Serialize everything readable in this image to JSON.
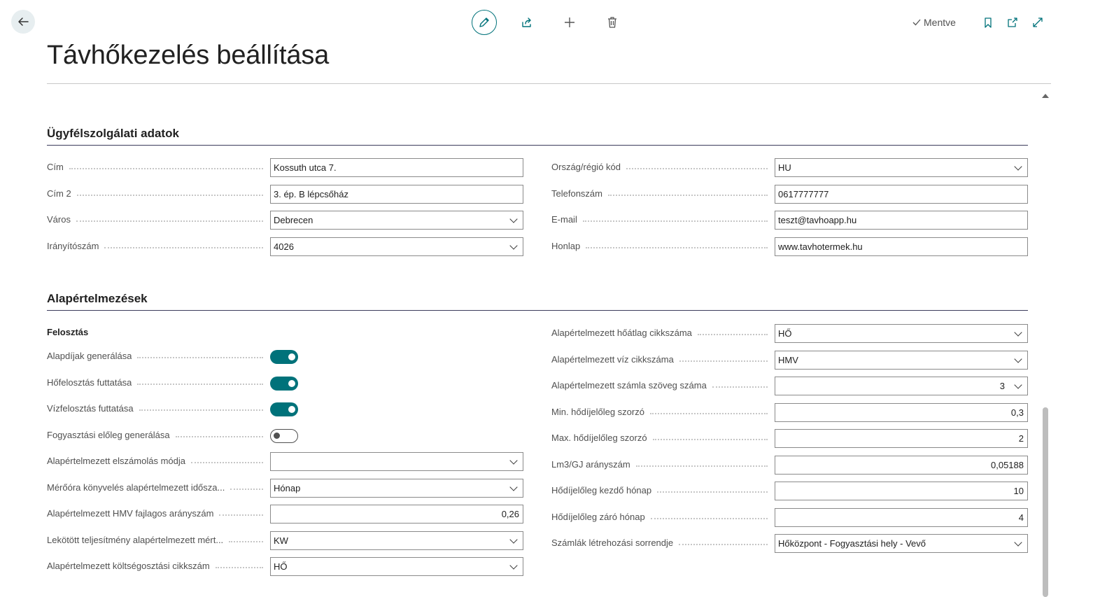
{
  "header": {
    "title": "Távhőkezelés beállítása",
    "saved_label": "Mentve"
  },
  "toolbar": {
    "icons": [
      "edit-icon",
      "share-icon",
      "plus-icon",
      "trash-icon",
      "bookmark-icon",
      "open-new-window-icon",
      "expand-icon"
    ]
  },
  "customer_service": {
    "title": "Ügyfélszolgálati adatok",
    "left": [
      {
        "label": "Cím",
        "value": "Kossuth utca 7.",
        "type": "text"
      },
      {
        "label": "Cím 2",
        "value": "3. ép. B lépcsőház",
        "type": "text"
      },
      {
        "label": "Város",
        "value": "Debrecen",
        "type": "select"
      },
      {
        "label": "Irányítószám",
        "value": "4026",
        "type": "select"
      }
    ],
    "right": [
      {
        "label": "Ország/régió kód",
        "value": "HU",
        "type": "select"
      },
      {
        "label": "Telefonszám",
        "value": "0617777777",
        "type": "text"
      },
      {
        "label": "E-mail",
        "value": "teszt@tavhoapp.hu",
        "type": "text"
      },
      {
        "label": "Honlap",
        "value": "www.tavhotermek.hu",
        "type": "text"
      }
    ]
  },
  "defaults": {
    "title": "Alapértelmezések",
    "group_title": "Felosztás",
    "toggles": [
      {
        "label": "Alapdíjak generálása",
        "on": true
      },
      {
        "label": "Hőfelosztás futtatása",
        "on": true
      },
      {
        "label": "Vízfelosztás futtatása",
        "on": true
      },
      {
        "label": "Fogyasztási előleg generálása",
        "on": false
      }
    ],
    "left_fields": [
      {
        "label": "Alapértelmezett elszámolás módja",
        "value": "",
        "type": "select"
      },
      {
        "label": "Mérőóra könyvelés alapértelmezett idősza...",
        "value": "Hónap",
        "type": "select"
      },
      {
        "label": "Alapértelmezett HMV fajlagos arányszám",
        "value": "0,26",
        "type": "number"
      },
      {
        "label": "Lekötött teljesítmény alapértelmezett mért...",
        "value": "KW",
        "type": "select"
      },
      {
        "label": "Alapértelmezett költségosztási cikkszám",
        "value": "HŐ",
        "type": "select"
      }
    ],
    "right_fields": [
      {
        "label": "Alapértelmezett hőátlag cikkszáma",
        "value": "HŐ",
        "type": "select"
      },
      {
        "label": "Alapértelmezett víz cikkszáma",
        "value": "HMV",
        "type": "select"
      },
      {
        "label": "Alapértelmezett számla szöveg száma",
        "value": "3",
        "type": "number-select"
      },
      {
        "label": "Min. hődíjelőleg szorzó",
        "value": "0,3",
        "type": "number"
      },
      {
        "label": "Max. hődíjelőleg szorzó",
        "value": "2",
        "type": "number"
      },
      {
        "label": "Lm3/GJ arányszám",
        "value": "0,05188",
        "type": "number"
      },
      {
        "label": "Hődíjelőleg kezdő hónap",
        "value": "10",
        "type": "number"
      },
      {
        "label": "Hődíjelőleg záró hónap",
        "value": "4",
        "type": "number"
      },
      {
        "label": "Számlák létrehozási sorrendje",
        "value": "Hőközpont - Fogyasztási hely - Vevő",
        "type": "select"
      }
    ]
  }
}
